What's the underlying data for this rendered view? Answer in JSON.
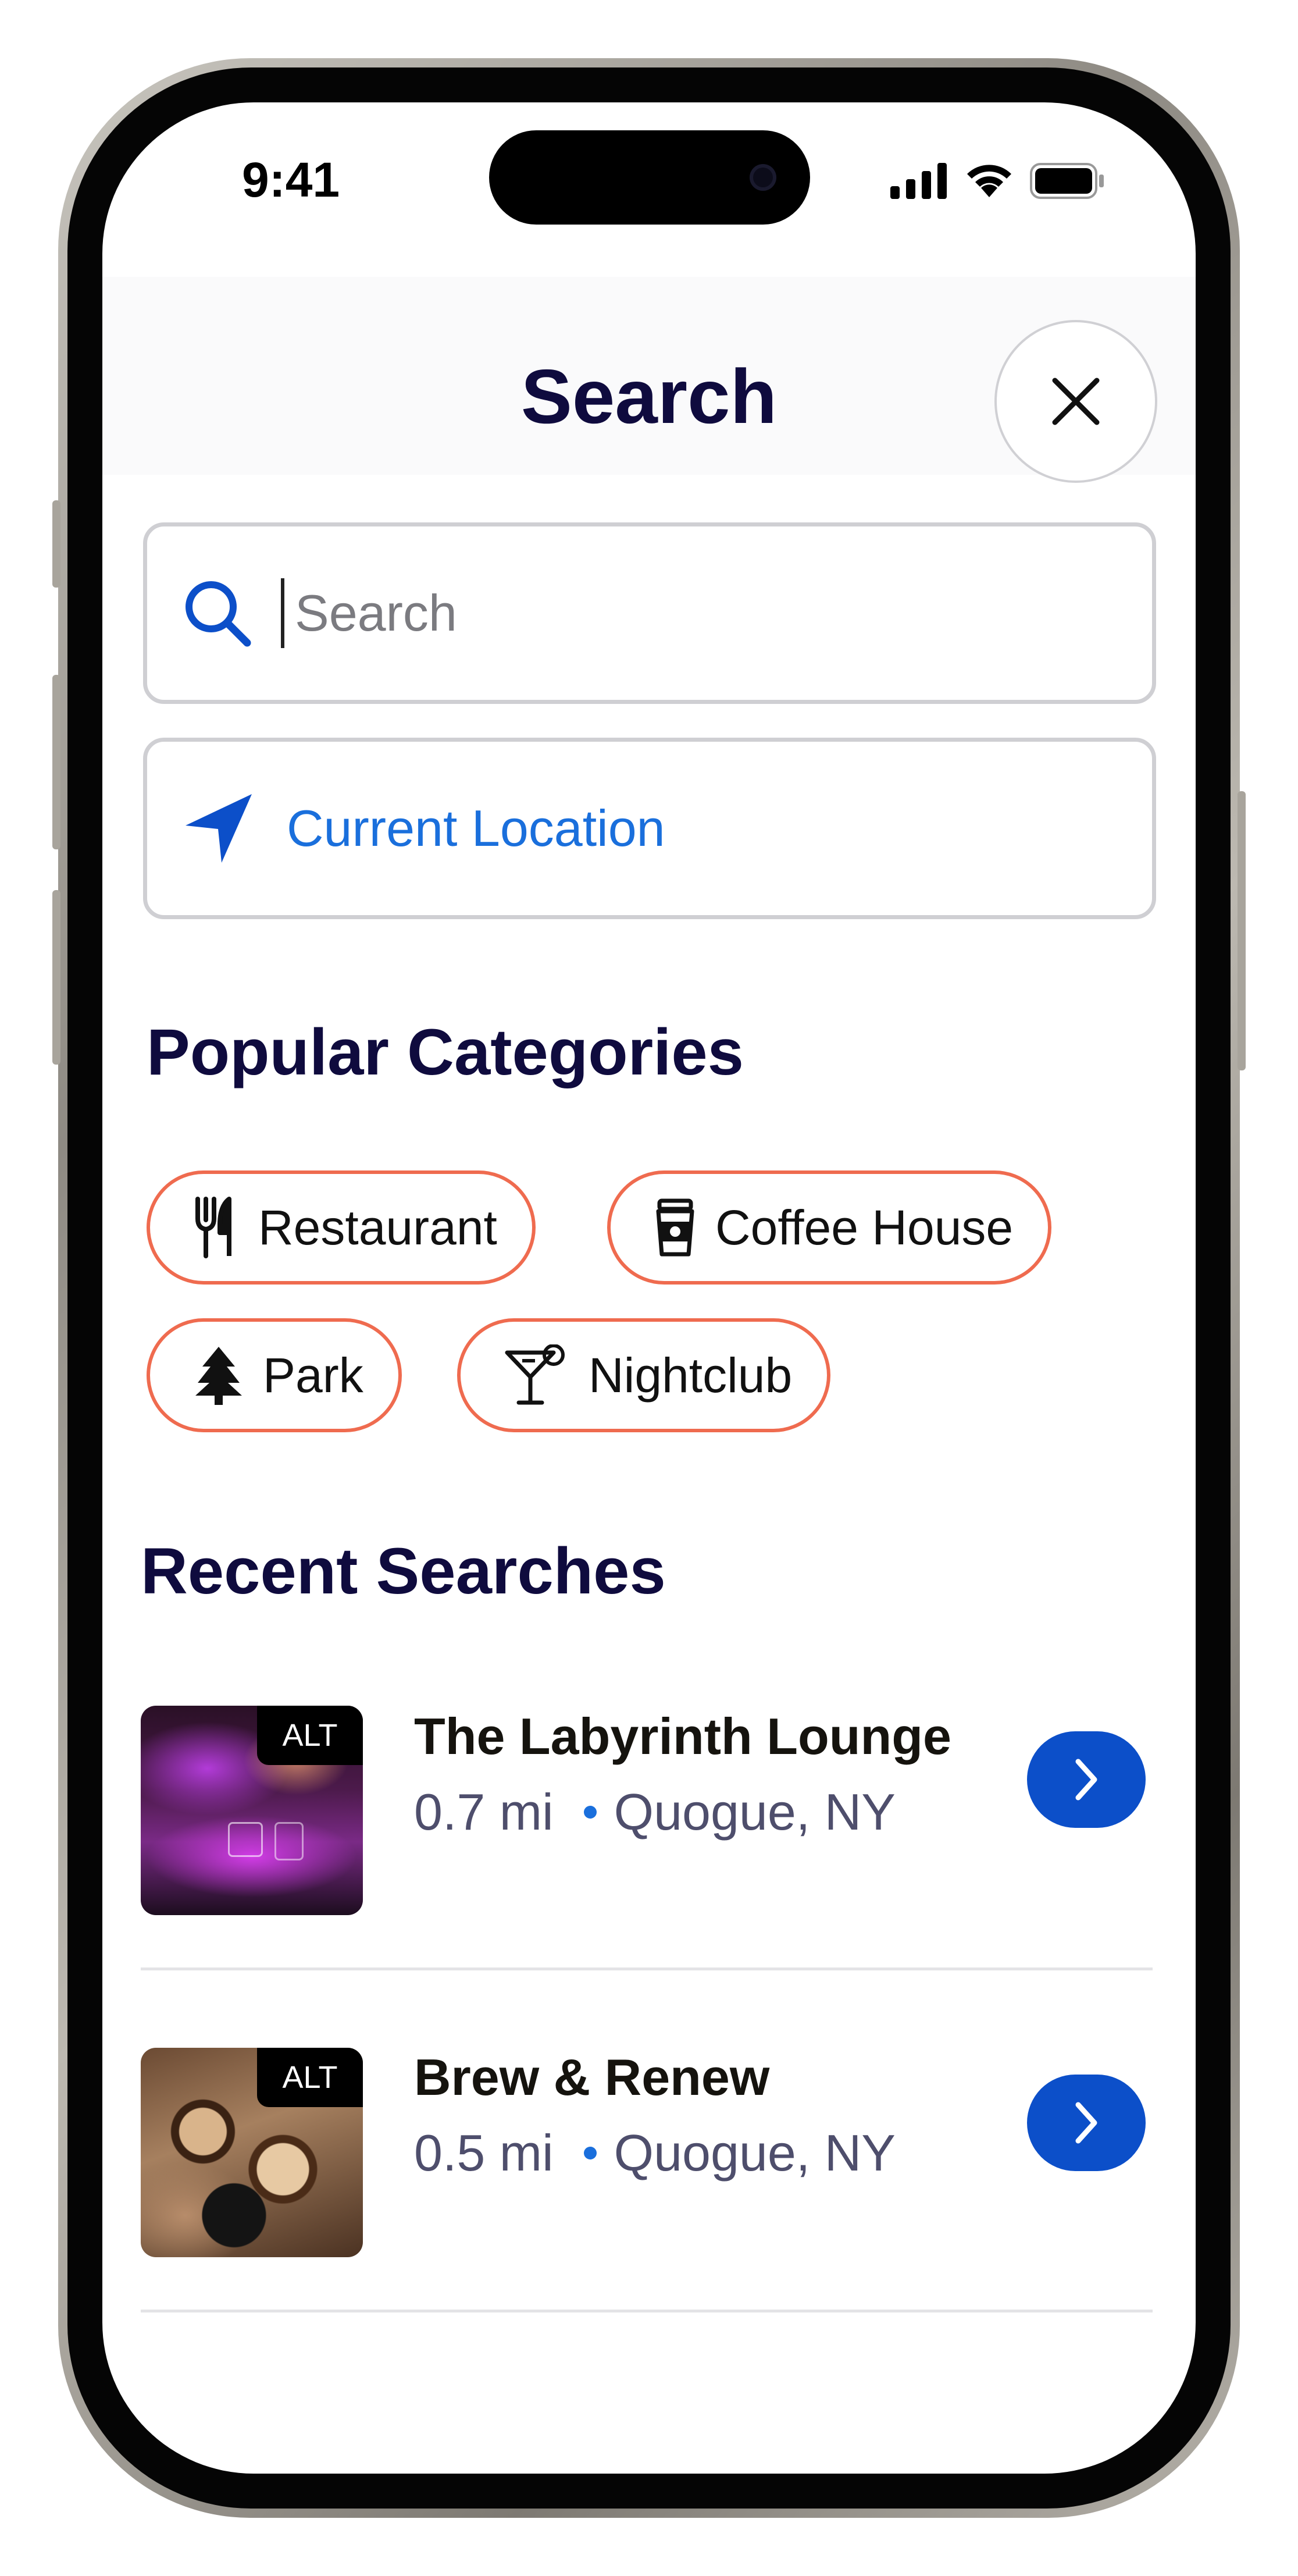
{
  "status_bar": {
    "time": "9:41"
  },
  "header": {
    "title": "Search"
  },
  "search": {
    "placeholder": "Search",
    "value": ""
  },
  "location": {
    "label": "Current Location"
  },
  "popular": {
    "title": "Popular Categories",
    "categories": [
      {
        "label": "Restaurant",
        "icon": "fork-knife-icon"
      },
      {
        "label": "Coffee House",
        "icon": "coffee-cup-icon"
      },
      {
        "label": "Park",
        "icon": "tree-icon"
      },
      {
        "label": "Nightclub",
        "icon": "cocktail-icon"
      }
    ]
  },
  "recent": {
    "title": "Recent Searches",
    "items": [
      {
        "name": "The Labyrinth Lounge",
        "distance": "0.7 mi",
        "place": "Quogue, NY",
        "badge": "ALT"
      },
      {
        "name": "Brew & Renew",
        "distance": "0.5 mi",
        "place": "Quogue, NY",
        "badge": "ALT"
      }
    ]
  },
  "colors": {
    "title": "#0f0b3e",
    "accent_blue": "#1a6fdc",
    "button_blue": "#0c4fc9",
    "chip_border": "#ef6b4f"
  }
}
